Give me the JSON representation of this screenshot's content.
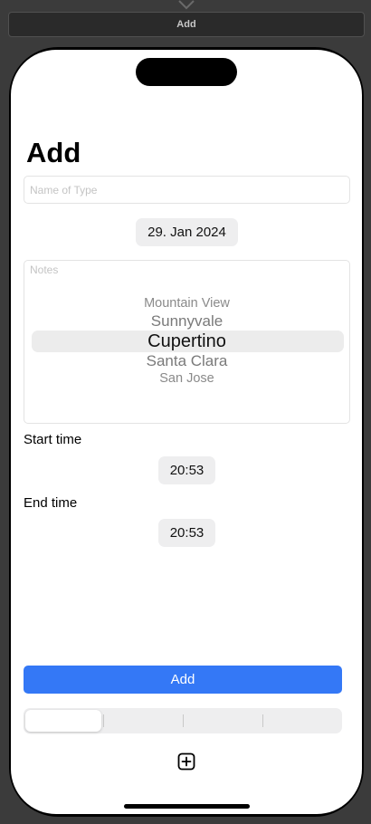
{
  "canvas": {
    "title": "Add"
  },
  "form": {
    "title": "Add",
    "name_placeholder": "Name of Type",
    "date_value": "29. Jan 2024",
    "notes_placeholder": "Notes",
    "picker": {
      "items": [
        "Mountain View",
        "Sunnyvale",
        "Cupertino",
        "Santa Clara",
        "San Jose"
      ],
      "selected": "Cupertino"
    },
    "start_time_label": "Start time",
    "start_time_value": "20:53",
    "end_time_label": "End time",
    "end_time_value": "20:53",
    "add_button_label": "Add",
    "segments": {
      "count": 4,
      "selected_index": 0
    }
  },
  "icons": {
    "plus": "plus-square-icon",
    "arrow": "arrow-down-icon"
  },
  "colors": {
    "accent": "#3478f6",
    "control_bg": "#eeeeef"
  }
}
